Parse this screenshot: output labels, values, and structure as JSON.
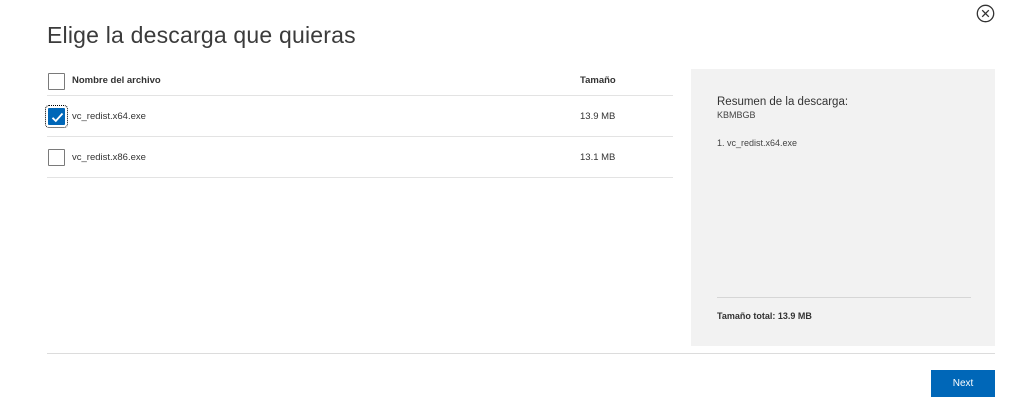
{
  "dialog": {
    "title": "Elige la descarga que quieras",
    "close_icon": "close-icon"
  },
  "table": {
    "headers": {
      "name": "Nombre del archivo",
      "size": "Tamaño"
    },
    "select_all_checked": false,
    "rows": [
      {
        "name": "vc_redist.x64.exe",
        "size": "13.9 MB",
        "checked": true
      },
      {
        "name": "vc_redist.x86.exe",
        "size": "13.1 MB",
        "checked": false
      }
    ]
  },
  "summary": {
    "title": "Resumen de la descarga:",
    "code": "KBMBGB",
    "items": [
      "1. vc_redist.x64.exe"
    ],
    "total": "Tamaño total: 13.9 MB"
  },
  "footer": {
    "next_label": "Next"
  },
  "colors": {
    "accent": "#0067b8",
    "summary_bg": "#f2f2f2"
  }
}
